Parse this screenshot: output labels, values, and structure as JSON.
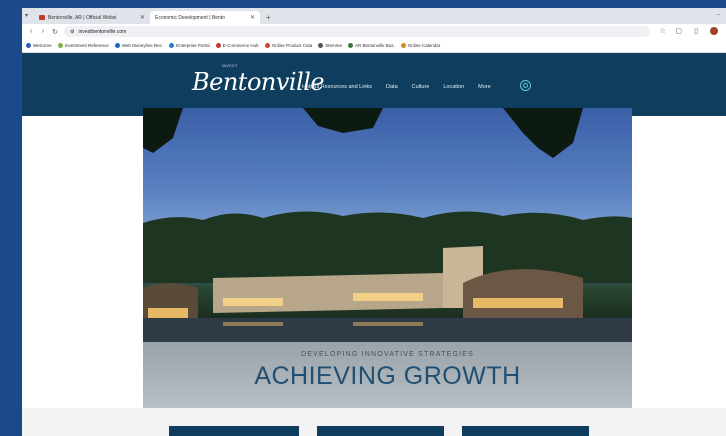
{
  "browser": {
    "tabs": [
      {
        "title": "Bentonville, AR | Official Websi",
        "active": false
      },
      {
        "title": "Economic Development | Bento",
        "active": true
      }
    ],
    "url": "investbentonville.com",
    "bookmarks": [
      "Welcome",
      "Investment Reference",
      "Web Moneyline Rec.",
      "Enterprise Portal",
      "E-Commerce Hub",
      "Online Product Cata",
      "Stemme",
      "AR Bentonville Bus.",
      "Online Calendar"
    ]
  },
  "site": {
    "logo_text": "Bentonville",
    "logo_small": "INVEST",
    "nav": [
      "Helpful Resources and Links",
      "Data",
      "Culture",
      "Location",
      "More"
    ]
  },
  "hero": {
    "eyebrow": "DEVELOPING INNOVATIVE STRATEGIES",
    "headline": "ACHIEVING GROWTH"
  },
  "colors": {
    "header_bg": "#0f3d5e",
    "desktop_bg": "#1b4a8c",
    "accent": "#5ec8d8"
  }
}
